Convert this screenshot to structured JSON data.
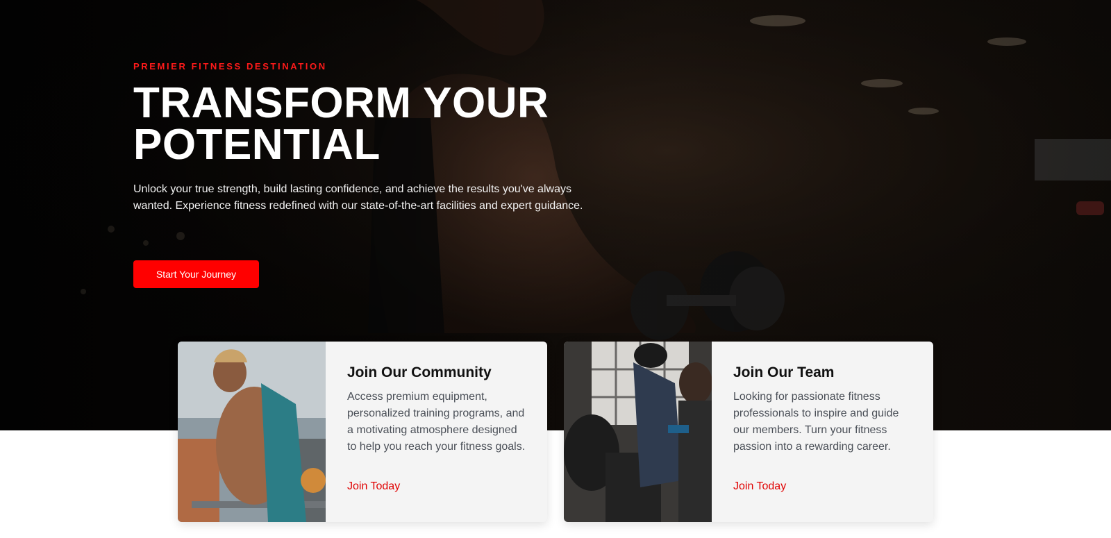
{
  "hero": {
    "eyebrow": "PREMIER FITNESS DESTINATION",
    "headline_line1": "TRANSFORM YOUR",
    "headline_line2": "POTENTIAL",
    "lead": "Unlock your true strength, build lasting confidence, and achieve the results you've always wanted. Experience fitness redefined with our state-of-the-art facilities and expert guidance.",
    "cta_label": "Start Your Journey",
    "image": "gym-athlete-dumbbell-photo"
  },
  "cards": [
    {
      "title": "Join Our Community",
      "text": "Access premium equipment, personalized training programs, and a motivating atmosphere designed to help you reach your fitness goals.",
      "link_label": "Join Today",
      "image": "athlete-dips-photo"
    },
    {
      "title": "Join Our Team",
      "text": "Looking for passionate fitness professionals to inspire and guide our members. Turn your fitness passion into a rewarding career.",
      "link_label": "Join Today",
      "image": "trainer-coaching-photo"
    }
  ],
  "colors": {
    "accent": "#ff0000",
    "link": "#e00000",
    "card_bg": "#f4f4f4"
  }
}
